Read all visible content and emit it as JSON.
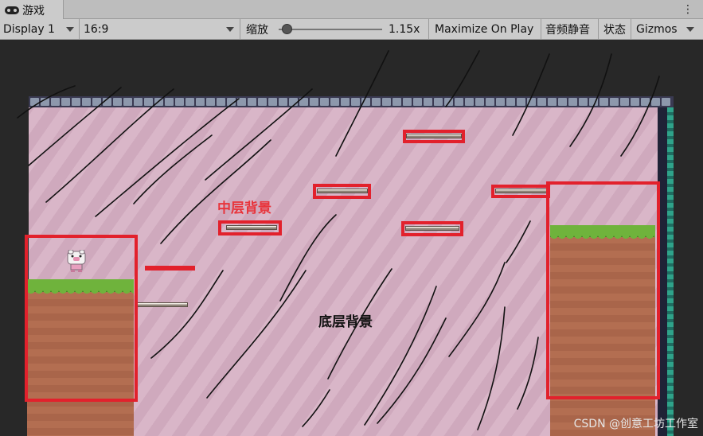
{
  "tab": {
    "title": "游戏",
    "icon": "gamepad-icon",
    "menu_icon": "⋮"
  },
  "toolbar": {
    "display": "Display 1",
    "aspect": "16:9",
    "scale_label": "缩放",
    "scale_value": "1.15x",
    "maximize": "Maximize On Play",
    "mute": "音频静音",
    "stats": "状态",
    "gizmos": "Gizmos"
  },
  "annotations": {
    "mid_layer": "中层背景",
    "bottom_layer": "底层背景"
  },
  "colors": {
    "highlight": "#e2212c",
    "mid_label": "#e8343b",
    "sky": "#d9b6c8",
    "grass": "#6fb33c",
    "dirt": "#b36e51"
  },
  "watermark": "CSDN @创意工坊工作室"
}
